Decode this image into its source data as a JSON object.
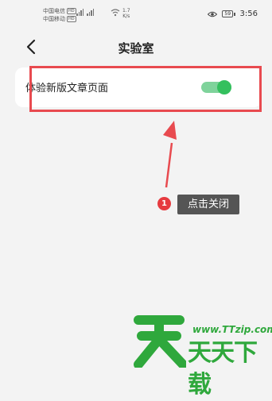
{
  "status_bar": {
    "carrier_1": "中国电信",
    "carrier_2": "中国移动",
    "hd_badge": "HD",
    "net_speed": "1.7",
    "net_speed_unit": "K/s",
    "battery_level": "59",
    "time": "3:56"
  },
  "nav": {
    "title": "实验室",
    "back_icon": "chevron-left-icon"
  },
  "settings": [
    {
      "label": "体验新版文章页面",
      "enabled": true
    }
  ],
  "annotation": {
    "step_number": "1",
    "callout_text": "点击关闭",
    "accent_color": "#e84a4f"
  },
  "watermark": {
    "url": "www.TTzip.com",
    "brand_text": "天天下载"
  },
  "colors": {
    "toggle_on": "#34c05e",
    "toggle_track": "#7fd39b",
    "watermark_green": "#2fa83c"
  }
}
